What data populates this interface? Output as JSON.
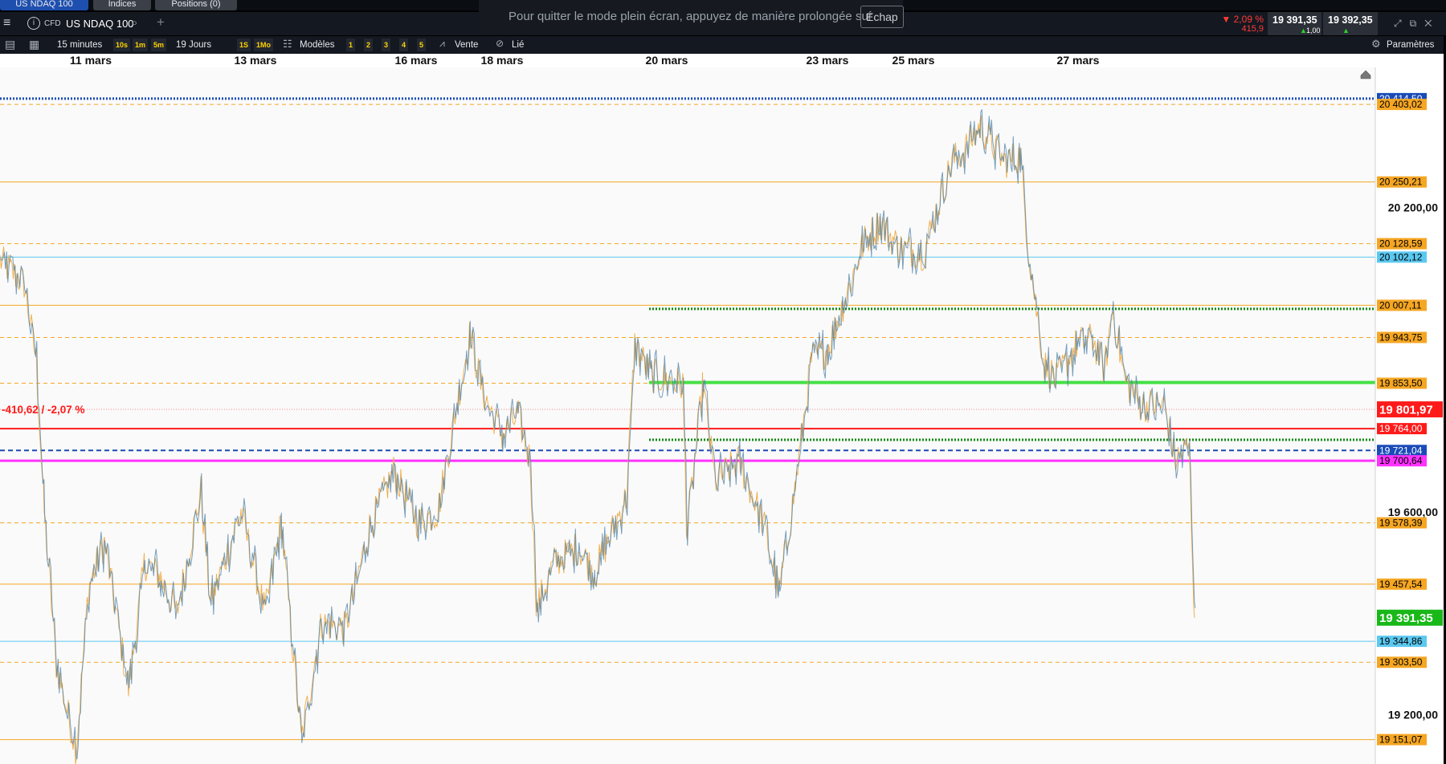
{
  "tabs": [
    {
      "label": "US NDAQ 100"
    },
    {
      "label": "Indices"
    },
    {
      "label": "Positions (0)"
    }
  ],
  "fullscreen_notice": {
    "message": "Pour quitter le mode plein écran, appuyez de manière prolongée sur",
    "key": "Échap"
  },
  "header": {
    "info_icon": "i",
    "instrument_type": "CFD",
    "instrument": "US NDAQ 100",
    "change_pct": "▼ 2,09 %",
    "change_val": "415,9",
    "sell_price": "19 391,35",
    "spread": "1,00",
    "buy_price": "19 392,35",
    "up_arrow": "▲"
  },
  "toolbar": {
    "timeframe": "15 minutes",
    "interval_keys": [
      "10s",
      "1m",
      "5m"
    ],
    "period": "19 Jours",
    "period_keys": [
      "1S",
      "1Mo"
    ],
    "templates": "Modèles",
    "layout_keys": [
      "1",
      "2",
      "3",
      "4",
      "5"
    ],
    "sell_btn": "Vente",
    "linked": "Lié",
    "settings": "Paramètres"
  },
  "chart_data": {
    "type": "line",
    "instrument": "US NDAQ 100",
    "x_labels": [
      {
        "label": "11 mars",
        "pos": 113
      },
      {
        "label": "13 mars",
        "pos": 318
      },
      {
        "label": "16 mars",
        "pos": 518
      },
      {
        "label": "18 mars",
        "pos": 625
      },
      {
        "label": "20 mars",
        "pos": 830
      },
      {
        "label": "23 mars",
        "pos": 1030
      },
      {
        "label": "25 mars",
        "pos": 1137
      },
      {
        "label": "27 mars",
        "pos": 1342
      }
    ],
    "ylim": [
      19103,
      20476
    ],
    "y_ticks": [
      {
        "value": 20200,
        "label": "20 200,00"
      },
      {
        "value": 19600,
        "label": "19 600,00"
      },
      {
        "value": 19200,
        "label": "19 200,00"
      }
    ],
    "series_keypoints": [
      [
        0,
        20095
      ],
      [
        30,
        20050
      ],
      [
        45,
        19900
      ],
      [
        55,
        19600
      ],
      [
        70,
        19300
      ],
      [
        95,
        19130
      ],
      [
        110,
        19450
      ],
      [
        130,
        19540
      ],
      [
        160,
        19250
      ],
      [
        180,
        19500
      ],
      [
        200,
        19470
      ],
      [
        220,
        19400
      ],
      [
        250,
        19640
      ],
      [
        262,
        19420
      ],
      [
        300,
        19600
      ],
      [
        330,
        19400
      ],
      [
        350,
        19580
      ],
      [
        375,
        19150
      ],
      [
        400,
        19380
      ],
      [
        430,
        19370
      ],
      [
        460,
        19570
      ],
      [
        490,
        19680
      ],
      [
        520,
        19580
      ],
      [
        545,
        19600
      ],
      [
        565,
        19780
      ],
      [
        585,
        19950
      ],
      [
        600,
        19840
      ],
      [
        625,
        19750
      ],
      [
        645,
        19790
      ],
      [
        660,
        19700
      ],
      [
        668,
        19410
      ],
      [
        690,
        19500
      ],
      [
        720,
        19530
      ],
      [
        740,
        19480
      ],
      [
        780,
        19630
      ],
      [
        790,
        19930
      ],
      [
        810,
        19870
      ],
      [
        830,
        19860
      ],
      [
        850,
        19850
      ],
      [
        855,
        19560
      ],
      [
        875,
        19850
      ],
      [
        890,
        19660
      ],
      [
        920,
        19700
      ],
      [
        950,
        19580
      ],
      [
        970,
        19440
      ],
      [
        990,
        19650
      ],
      [
        1010,
        19900
      ],
      [
        1030,
        19920
      ],
      [
        1050,
        20010
      ],
      [
        1075,
        20130
      ],
      [
        1095,
        20170
      ],
      [
        1120,
        20120
      ],
      [
        1150,
        20110
      ],
      [
        1165,
        20190
      ],
      [
        1185,
        20290
      ],
      [
        1200,
        20310
      ],
      [
        1220,
        20360
      ],
      [
        1250,
        20290
      ],
      [
        1270,
        20300
      ],
      [
        1280,
        20120
      ],
      [
        1290,
        20000
      ],
      [
        1300,
        19890
      ],
      [
        1315,
        19860
      ],
      [
        1340,
        19930
      ],
      [
        1360,
        19940
      ],
      [
        1375,
        19880
      ],
      [
        1385,
        20000
      ],
      [
        1400,
        19860
      ],
      [
        1420,
        19810
      ],
      [
        1450,
        19810
      ],
      [
        1462,
        19700
      ],
      [
        1480,
        19730
      ],
      [
        1487,
        19391
      ]
    ],
    "levels": [
      {
        "value": 20414.5,
        "label": "20 414,50",
        "color": "#1a4bb8",
        "style": "dotted",
        "width": 3,
        "x0": 0,
        "bg": "#1a4bb8",
        "fg": "#ffffff"
      },
      {
        "value": 20403.02,
        "label": "20 403,02",
        "color": "#f5a623",
        "style": "dashed",
        "width": 1,
        "x0": 0,
        "bg": "#f5a623",
        "fg": "#000000"
      },
      {
        "value": 20250.21,
        "label": "20 250,21",
        "color": "#f5a623",
        "style": "solid",
        "width": 1,
        "x0": 0,
        "bg": "#f5a623",
        "fg": "#000000"
      },
      {
        "value": 20128.59,
        "label": "20 128,59",
        "color": "#f5a623",
        "style": "dashed",
        "width": 1,
        "x0": 0,
        "bg": "#f5a623",
        "fg": "#000000"
      },
      {
        "value": 20102.12,
        "label": "20 102,12",
        "color": "#5bc8f0",
        "style": "solid",
        "width": 1,
        "x0": 0,
        "bg": "#5bc8f0",
        "fg": "#000000"
      },
      {
        "value": 20007.11,
        "label": "20 007,11",
        "color": "#f5a623",
        "style": "solid",
        "width": 1,
        "x0": 0,
        "bg": "#f5a623",
        "fg": "#000000"
      },
      {
        "value": 19943.75,
        "label": "19 943,75",
        "color": "#f5a623",
        "style": "dashed",
        "width": 1,
        "x0": 0,
        "bg": "#f5a623",
        "fg": "#000000"
      },
      {
        "value": 19853.5,
        "label": "19 853,50",
        "color": "#f5a623",
        "style": "dashed",
        "width": 1,
        "x0": 0,
        "bg": "#f5a623",
        "fg": "#000000"
      },
      {
        "value": 19764.0,
        "label": "19 764,00",
        "color": "#ff1a1a",
        "style": "solid",
        "width": 2,
        "x0": 0,
        "bg": "#ff1a1a",
        "fg": "#ffffff"
      },
      {
        "value": 19721.04,
        "label": "19 721,04",
        "color": "#1a4bb8",
        "style": "dashed",
        "width": 2,
        "x0": 0,
        "bg": "#1a4bb8",
        "fg": "#ffffff"
      },
      {
        "value": 19700.64,
        "label": "19 700,64",
        "color": "#ff33ff",
        "style": "solid",
        "width": 3,
        "x0": 0,
        "bg": "#ff33ff",
        "fg": "#000000"
      },
      {
        "value": 19578.39,
        "label": "19 578,39",
        "color": "#f5a623",
        "style": "dashed",
        "width": 1,
        "x0": 0,
        "bg": "#f5a623",
        "fg": "#000000"
      },
      {
        "value": 19457.54,
        "label": "19 457,54",
        "color": "#f5a623",
        "style": "solid",
        "width": 1,
        "x0": 0,
        "bg": "#f5a623",
        "fg": "#000000"
      },
      {
        "value": 19344.86,
        "label": "19 344,86",
        "color": "#5bc8f0",
        "style": "solid",
        "width": 1,
        "x0": 0,
        "bg": "#5bc8f0",
        "fg": "#000000"
      },
      {
        "value": 19303.5,
        "label": "19 303,50",
        "color": "#f5a623",
        "style": "dashed",
        "width": 1,
        "x0": 0,
        "bg": "#f5a623",
        "fg": "#000000"
      },
      {
        "value": 19151.07,
        "label": "19 151,07",
        "color": "#f5a623",
        "style": "solid",
        "width": 1,
        "x0": 0,
        "bg": "#f5a623",
        "fg": "#000000"
      }
    ],
    "green_lines": [
      {
        "value": 20000,
        "color": "#118a11",
        "style": "dotted",
        "width": 3,
        "x0": 808
      },
      {
        "value": 19855,
        "color": "#44e044",
        "style": "solid",
        "width": 4,
        "x0": 808
      },
      {
        "value": 19742,
        "color": "#118a11",
        "style": "dotted",
        "width": 3,
        "x0": 808
      }
    ],
    "reference": {
      "value": 19801.97,
      "label": "19 801,97",
      "color": "#ff1a1a",
      "change_label": "-410,62 / -2,07 %"
    },
    "last": {
      "value": 19391.35,
      "label": "19 391,35",
      "color": "#18b818"
    },
    "red_reference_line": {
      "value": 19801.97
    }
  }
}
